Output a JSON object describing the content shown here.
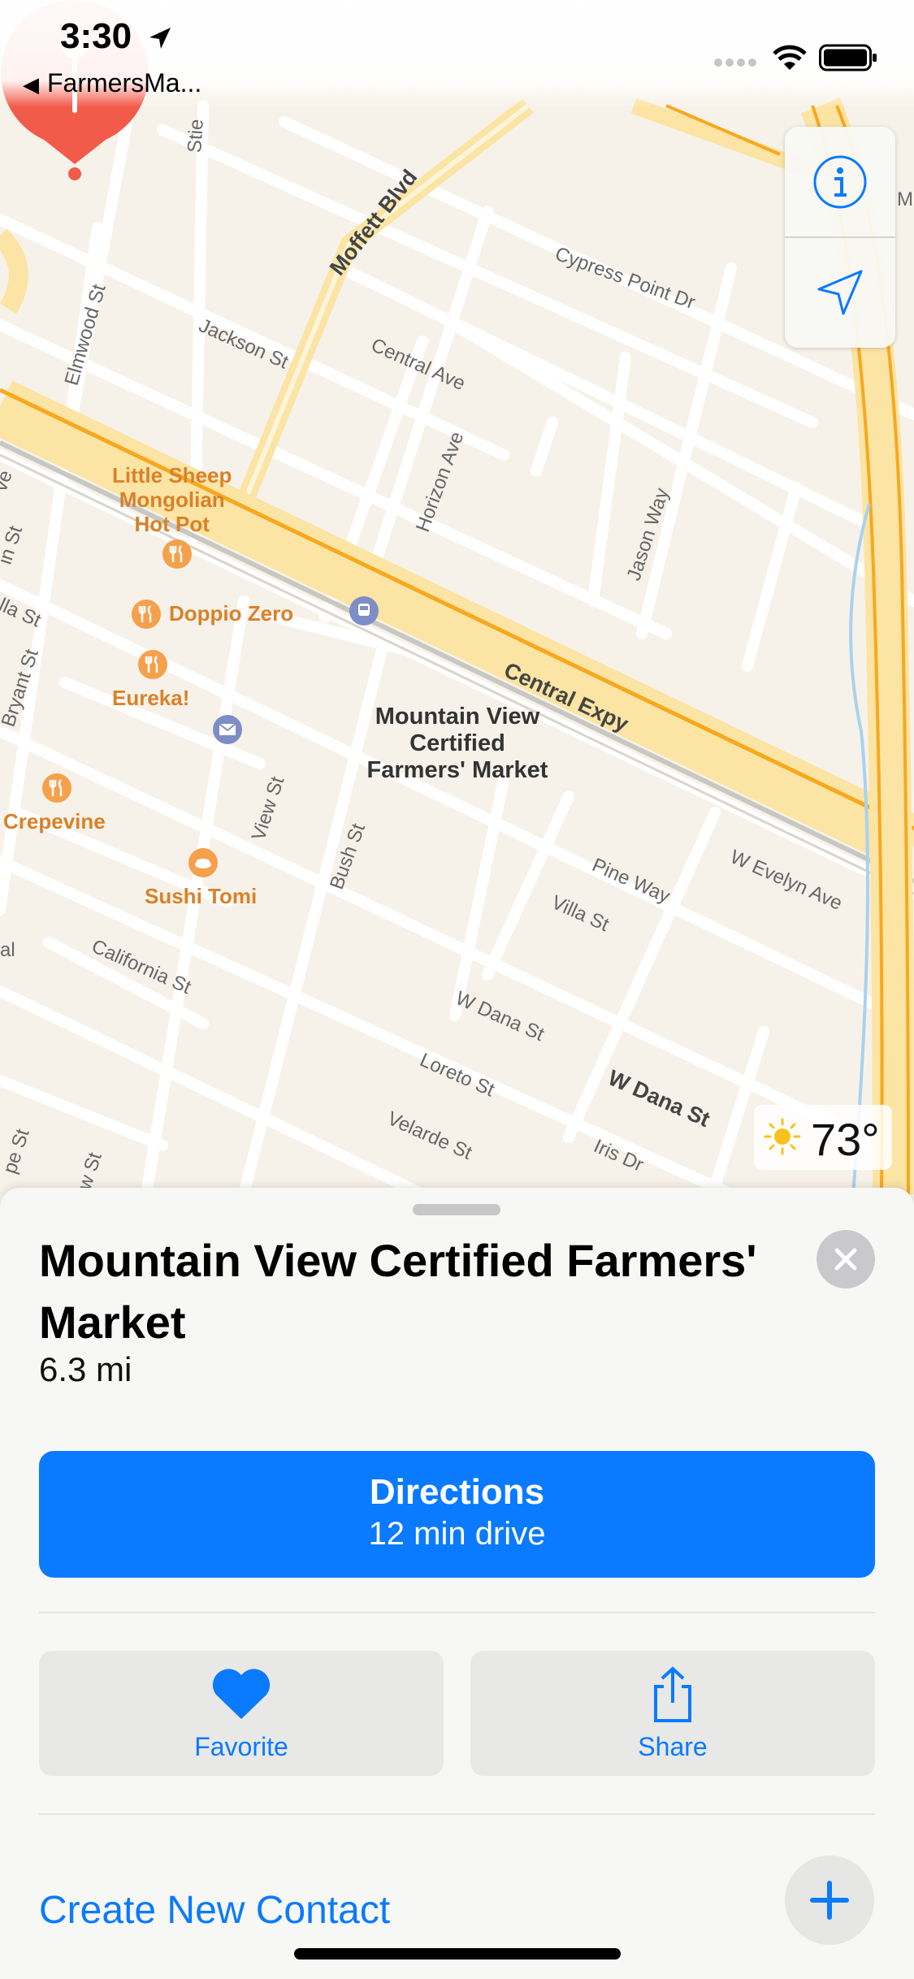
{
  "status_bar": {
    "time": "3:30",
    "back_app": "FarmersMa..."
  },
  "map": {
    "pin_label_lines": [
      "Mountain View",
      "Certified",
      "Farmers' Market"
    ],
    "weather": {
      "temp": "73°",
      "icon": "sun-icon"
    },
    "pois": [
      {
        "name_lines": [
          "Little Sheep",
          "Mongolian",
          "Hot Pot"
        ],
        "icon": "restaurant-icon"
      },
      {
        "name": "Doppio Zero",
        "icon": "restaurant-icon"
      },
      {
        "name": "Eureka!",
        "icon": "restaurant-icon"
      },
      {
        "name": "Crepevine",
        "icon": "restaurant-icon"
      },
      {
        "name": "Sushi Tomi",
        "icon": "sushi-icon"
      }
    ],
    "streets": {
      "moffett": "Moffett Blvd",
      "cypress": "Cypress Point Dr",
      "jackson": "Jackson St",
      "central_ave": "Central Ave",
      "elmwood": "Elmwood St",
      "horizon": "Horizon Ave",
      "jason": "Jason Way",
      "central_expy": "Central Expy",
      "view": "View St",
      "bush": "Bush St",
      "pine": "Pine Way",
      "evelyn": "W Evelyn Ave",
      "villa": "Villa St",
      "california": "California St",
      "w_dana_small": "W Dana St",
      "w_dana_bold": "W Dana St",
      "loreto": "Loreto St",
      "velarde": "Velarde St",
      "iris": "Iris Dr",
      "bryant": "Bryant St",
      "stie": "Stie",
      "m_edge": "M",
      "ve_edge": "ve",
      "lla_edge": "lla St",
      "in_edge": "in St",
      "al_edge": "al",
      "pe_edge": "pe St",
      "w_edge": "w St"
    }
  },
  "sheet": {
    "title": "Mountain View Certified Farmers' Market",
    "distance": "6.3 mi",
    "directions": {
      "label": "Directions",
      "sub": "12 min drive"
    },
    "favorite": "Favorite",
    "share": "Share",
    "create_contact": "Create New Contact"
  },
  "colors": {
    "accent": "#0A7AFF",
    "pin": "#F25A4A",
    "poi": "#D98128",
    "highway": "#F7A81E"
  }
}
